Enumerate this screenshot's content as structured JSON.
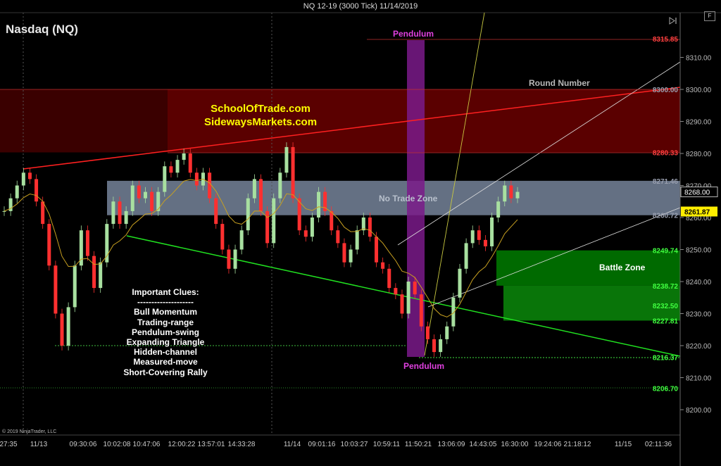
{
  "header": {
    "title": "NQ 12-19 (3000 Tick)  11/14/2019"
  },
  "symbol_label": "Nasdaq (NQ)",
  "copyright": "© 2019 NinjaTrader, LLC",
  "toolbar": {
    "f_button": "F",
    "play_icon": "play-to-end-icon"
  },
  "brand": {
    "line1": "SchoolOfTrade.com",
    "line2": "SidewaysMarkets.com"
  },
  "annotations": {
    "round_number": "Round Number",
    "no_trade_zone": "No Trade Zone",
    "battle_zone": "Battle Zone",
    "pendulum_top": "Pendulum",
    "pendulum_bottom": "Pendulum"
  },
  "clues": {
    "title": "Important Clues:",
    "separator": "--------------------",
    "items": [
      "Bull Momentum",
      "Trading-range",
      "Pendulum-swing",
      "Expanding Triangle",
      "Hidden-channel",
      "Measured-move",
      "Short-Covering Rally"
    ]
  },
  "colors": {
    "background": "#000000",
    "candle_up": "#a8e0a0",
    "candle_down": "#ff3030",
    "red_zone": "#5a0000",
    "no_trade_zone": "#8090a8",
    "battle_zone": "#006a00",
    "pendulum_bar": "#7a1a8a"
  },
  "chart_data": {
    "type": "line",
    "title": "NQ 12-19 (3000 Tick)  11/14/2019",
    "ylim": [
      8191,
      8323
    ],
    "y_ticks": [
      8200,
      8210,
      8220,
      8230,
      8240,
      8250,
      8260,
      8270,
      8280,
      8290,
      8300,
      8310
    ],
    "x_ticks": [
      "27:35",
      "11/13",
      "09:30:06",
      "10:02:08",
      "10:47:06",
      "12:00:22",
      "13:57:01",
      "14:33:28",
      "11/14",
      "09:01:16",
      "10:03:27",
      "10:59:11",
      "11:50:21",
      "13:06:09",
      "14:43:05",
      "16:30:00",
      "19:24:06",
      "21:18:12",
      "11/15",
      "02:11:36"
    ],
    "current_price": "8268.00",
    "last_price": "8261.87",
    "series": [
      {
        "values": [
          8262,
          8266,
          8270,
          8274,
          8272,
          8265,
          8258,
          8245,
          8230,
          8220,
          8232,
          8245,
          8256,
          8248,
          8238,
          8246,
          8258,
          8265,
          8258,
          8262,
          8270,
          8266,
          8268,
          8262,
          8268,
          8276,
          8274,
          8278,
          8280,
          8274,
          8270,
          8274,
          8266,
          8258,
          8250,
          8244,
          8250,
          8256,
          8266,
          8272,
          8262,
          8252,
          8266,
          8274,
          8282,
          8266,
          8256,
          8254,
          8260,
          8268,
          8262,
          8256,
          8252,
          8246,
          8250,
          8256,
          8260,
          8254,
          8246,
          8244,
          8238,
          8236,
          8230,
          8240,
          8236,
          8226,
          8222,
          8218,
          8222,
          8226,
          8235,
          8244,
          8252,
          8256,
          8253,
          8251,
          8260,
          8265,
          8270,
          8266,
          8268
        ]
      }
    ],
    "levels": [
      {
        "label": "8315.85",
        "value": 8315.85
      },
      {
        "label": "8300.00",
        "value": 8300.0
      },
      {
        "label": "8280.33",
        "value": 8280.33
      },
      {
        "label": "8271.46",
        "value": 8271.46
      },
      {
        "label": "8260.72",
        "value": 8260.72
      },
      {
        "label": "8249.74",
        "value": 8249.74
      },
      {
        "label": "8238.72",
        "value": 8238.72
      },
      {
        "label": "8232.50",
        "value": 8232.5
      },
      {
        "label": "8227.81",
        "value": 8227.81
      },
      {
        "label": "8216.37",
        "value": 8216.37
      },
      {
        "label": "8206.70",
        "value": 8206.7
      }
    ]
  }
}
